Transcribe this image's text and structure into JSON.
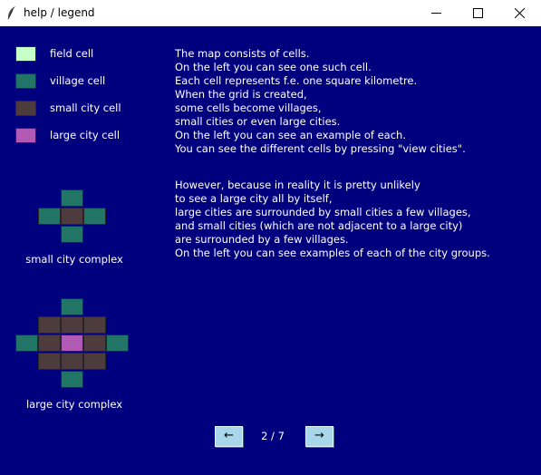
{
  "window": {
    "title": "help / legend"
  },
  "legend": [
    {
      "label": "field cell",
      "color": "#c8ffc8"
    },
    {
      "label": "village cell",
      "color": "#227566"
    },
    {
      "label": "small city cell",
      "color": "#4d3b3d"
    },
    {
      "label": "large city cell",
      "color": "#b05ab5"
    }
  ],
  "text": {
    "paragraph1": [
      "The map consists of cells.",
      "On the left you can see one such cell.",
      "Each cell represents f.e. one square kilometre.",
      "When the grid is created,",
      "some cells become villages,",
      "small cities or even large cities.",
      "On the left you can see an example of each.",
      "You can see the different cells by pressing \"view cities\"."
    ],
    "paragraph2": [
      "However, because in reality it is pretty unlikely",
      "to see a large city all by itself,",
      "large cities are surrounded by small cities a few villages,",
      "and small cities (which are not adjacent to a large city)",
      "are surrounded by a few villages.",
      "On the left you can see examples of each of the city groups."
    ]
  },
  "complexes": {
    "small_caption": "small city complex",
    "large_caption": "large city complex"
  },
  "nav": {
    "prev_label": "←",
    "next_label": "→",
    "page_indicator": "2 / 7"
  },
  "colors": {
    "background": "#00007f",
    "field": "#c8ffc8",
    "village": "#227566",
    "small_city": "#4d3b3d",
    "large_city": "#b05ab5",
    "button": "#a8d7eb"
  }
}
